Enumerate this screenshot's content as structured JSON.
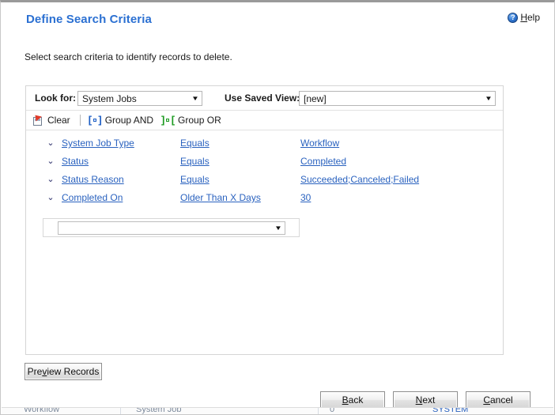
{
  "window": {
    "title": "Define Search Criteria"
  },
  "header": {
    "title": "Define Search Criteria",
    "help": {
      "icon": "help-question-icon",
      "label_prefix": "",
      "accel": "H",
      "label_rest": "elp"
    }
  },
  "instruction": "Select search criteria to identify records to delete.",
  "panel": {
    "look_for": {
      "label": "Look for:",
      "value": "System Jobs",
      "arrow": "▼"
    },
    "saved_view": {
      "label": "Use Saved View:",
      "value": "[new]",
      "arrow": "▼"
    },
    "toolbar": [
      {
        "name": "clear",
        "label": "Clear",
        "icon": "clear-page-icon"
      },
      {
        "name": "group-and",
        "label": "Group AND",
        "icon": "group-and-bracket-icon"
      },
      {
        "name": "group-or",
        "label": "Group OR",
        "icon": "group-or-bracket-icon"
      }
    ],
    "criteria": [
      {
        "chevron": "⌄",
        "field": "System Job Type",
        "operator": "Equals",
        "value": "Workflow"
      },
      {
        "chevron": "⌄",
        "field": "Status",
        "operator": "Equals",
        "value": "Completed"
      },
      {
        "chevron": "⌄",
        "field": "Status Reason",
        "operator": "Equals",
        "value": "Succeeded;Canceled;Failed"
      },
      {
        "chevron": "⌄",
        "field": "Completed On",
        "operator": "Older Than X Days",
        "value": "30"
      }
    ],
    "new_row": {
      "value": "",
      "placeholder": "",
      "arrow": "▼"
    }
  },
  "footer": {
    "preview": {
      "pre": "Pre",
      "accel": "v",
      "post": "iew Records"
    },
    "back": {
      "pre": "",
      "accel": "B",
      "post": "ack"
    },
    "next": {
      "pre": "",
      "accel": "N",
      "post": "ext"
    },
    "cancel": {
      "pre": "",
      "accel": "C",
      "post": "ancel"
    }
  },
  "colors": {
    "title_blue": "#2b70d2",
    "link_blue": "#2a62bf",
    "chevron": "#2c2f6b",
    "group_and": "#1f5fc4",
    "group_or": "#1d9b22",
    "clear_red": "#e03b2a"
  }
}
